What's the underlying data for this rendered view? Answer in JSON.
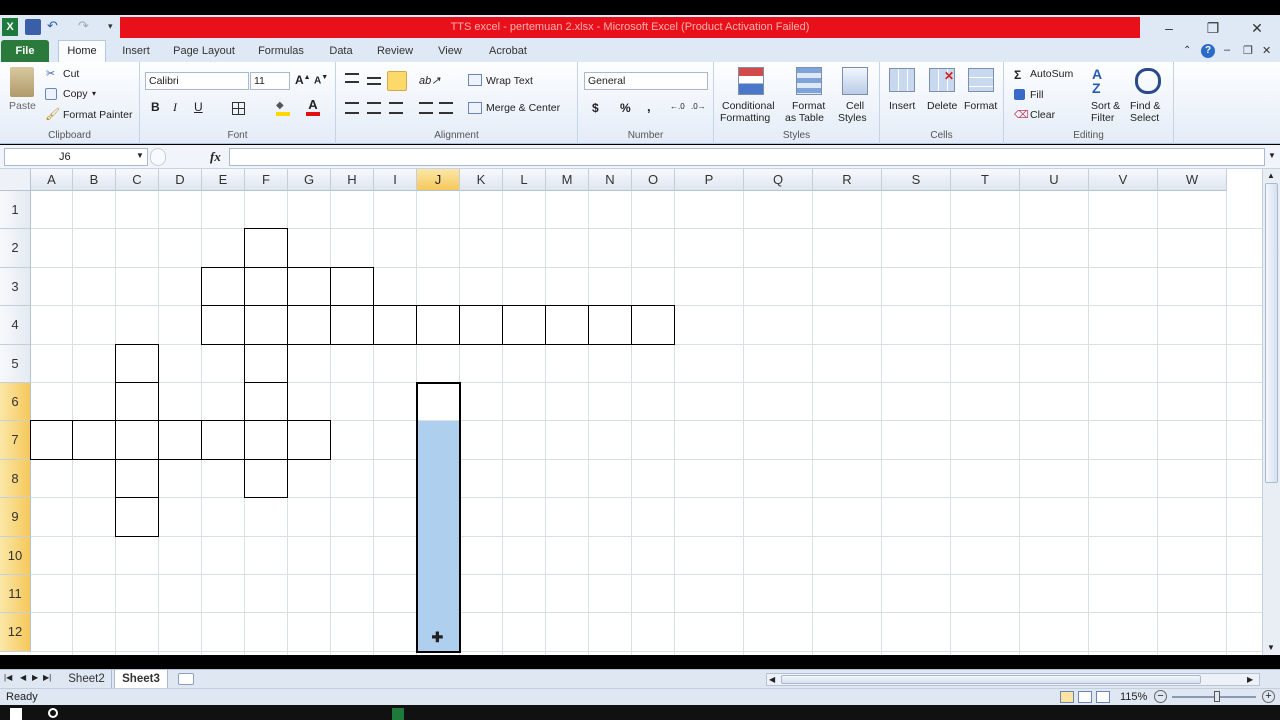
{
  "window": {
    "title": "TTS excel - pertemuan 2.xlsx  -  Microsoft Excel (Product Activation Failed)"
  },
  "tabs": [
    "File",
    "Home",
    "Insert",
    "Page Layout",
    "Formulas",
    "Data",
    "Review",
    "View",
    "Acrobat"
  ],
  "ribbon": {
    "clipboard": {
      "paste": "Paste",
      "cut": "Cut",
      "copy": "Copy",
      "format_painter": "Format Painter",
      "label": "Clipboard"
    },
    "font": {
      "name": "Calibri",
      "size": "11",
      "bold": "B",
      "italic": "I",
      "underline": "U",
      "label": "Font"
    },
    "alignment": {
      "wrap_text": "Wrap Text",
      "merge_center": "Merge & Center",
      "label": "Alignment"
    },
    "number": {
      "format": "General",
      "currency": "$",
      "percent": "%",
      "comma": ",",
      "label": "Number"
    },
    "styles": {
      "conditional": "Conditional",
      "conditional2": "Formatting",
      "format_table": "Format",
      "format_table2": "as Table",
      "cell_styles": "Cell",
      "cell_styles2": "Styles",
      "label": "Styles"
    },
    "cells": {
      "insert": "Insert",
      "delete": "Delete",
      "format": "Format",
      "label": "Cells"
    },
    "editing": {
      "autosum": "AutoSum",
      "fill": "Fill",
      "clear": "Clear",
      "sort": "Sort &",
      "sort2": "Filter",
      "find": "Find &",
      "find2": "Select",
      "label": "Editing"
    }
  },
  "formula_bar": {
    "name_box": "J6",
    "fx": "fx",
    "value": ""
  },
  "columns": [
    "A",
    "B",
    "C",
    "D",
    "E",
    "F",
    "G",
    "H",
    "I",
    "J",
    "K",
    "L",
    "M",
    "N",
    "O",
    "P",
    "Q",
    "R",
    "S",
    "T",
    "U",
    "V",
    "W"
  ],
  "rows": [
    "1",
    "2",
    "3",
    "4",
    "5",
    "6",
    "7",
    "8",
    "9",
    "10",
    "11",
    "12"
  ],
  "active_column": "J",
  "selected_rows": [
    "6",
    "7",
    "8",
    "9",
    "10",
    "11",
    "12"
  ],
  "bordered_cells": [
    "F2",
    "E3",
    "F3",
    "G3",
    "H3",
    "E4",
    "F4",
    "G4",
    "H4",
    "I4",
    "J4",
    "K4",
    "L4",
    "M4",
    "N4",
    "O4",
    "C5",
    "F5",
    "C6",
    "F6",
    "A7",
    "B7",
    "C7",
    "D7",
    "E7",
    "F7",
    "G7",
    "C8",
    "F8",
    "C9"
  ],
  "selection": {
    "range": "J6:J12",
    "active": "J6"
  },
  "sheets": [
    "Sheet2",
    "Sheet3"
  ],
  "active_sheet": "Sheet3",
  "status": {
    "ready": "Ready",
    "zoom": "115%"
  }
}
